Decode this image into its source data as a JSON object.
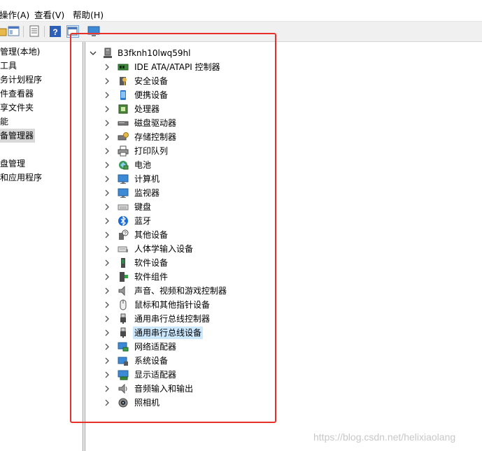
{
  "menu": {
    "action": "操作(A)",
    "view": "查看(V)",
    "help": "帮助(H)"
  },
  "left_tree": {
    "items": [
      {
        "label": "管理(本地)"
      },
      {
        "label": "工具"
      },
      {
        "label": "务计划程序"
      },
      {
        "label": "件查看器"
      },
      {
        "label": "享文件夹"
      },
      {
        "label": "能"
      },
      {
        "label": "备管理器",
        "selected": true
      },
      {
        "label": ""
      },
      {
        "label": "盘管理"
      },
      {
        "label": "和应用程序"
      }
    ]
  },
  "device_tree": {
    "root": {
      "label": "B3fknh10lwq59hl",
      "icon": "computer-icon"
    },
    "categories": [
      {
        "label": "IDE ATA/ATAPI 控制器",
        "icon": "ide-controller-icon"
      },
      {
        "label": "安全设备",
        "icon": "security-device-icon"
      },
      {
        "label": "便携设备",
        "icon": "portable-device-icon"
      },
      {
        "label": "处理器",
        "icon": "processor-icon"
      },
      {
        "label": "磁盘驱动器",
        "icon": "disk-drive-icon"
      },
      {
        "label": "存储控制器",
        "icon": "storage-controller-icon"
      },
      {
        "label": "打印队列",
        "icon": "printer-icon"
      },
      {
        "label": "电池",
        "icon": "battery-icon"
      },
      {
        "label": "计算机",
        "icon": "monitor-icon"
      },
      {
        "label": "监视器",
        "icon": "monitor-icon"
      },
      {
        "label": "键盘",
        "icon": "keyboard-icon"
      },
      {
        "label": "蓝牙",
        "icon": "bluetooth-icon"
      },
      {
        "label": "其他设备",
        "icon": "unknown-device-icon"
      },
      {
        "label": "人体学输入设备",
        "icon": "hid-icon"
      },
      {
        "label": "软件设备",
        "icon": "software-device-icon"
      },
      {
        "label": "软件组件",
        "icon": "software-component-icon"
      },
      {
        "label": "声音、视频和游戏控制器",
        "icon": "speaker-icon"
      },
      {
        "label": "鼠标和其他指针设备",
        "icon": "mouse-icon"
      },
      {
        "label": "通用串行总线控制器",
        "icon": "usb-icon"
      },
      {
        "label": "通用串行总线设备",
        "icon": "usb-icon",
        "selected": true
      },
      {
        "label": "网络适配器",
        "icon": "network-adapter-icon"
      },
      {
        "label": "系统设备",
        "icon": "system-device-icon"
      },
      {
        "label": "显示适配器",
        "icon": "display-adapter-icon"
      },
      {
        "label": "音频输入和输出",
        "icon": "audio-io-icon"
      },
      {
        "label": "照相机",
        "icon": "camera-icon"
      }
    ]
  },
  "watermark": "https://blog.csdn.net/helixiaolang",
  "colors": {
    "selection": "#cce8ff",
    "highlight_box": "#e8302a",
    "left_selection": "#d9d9d9"
  }
}
